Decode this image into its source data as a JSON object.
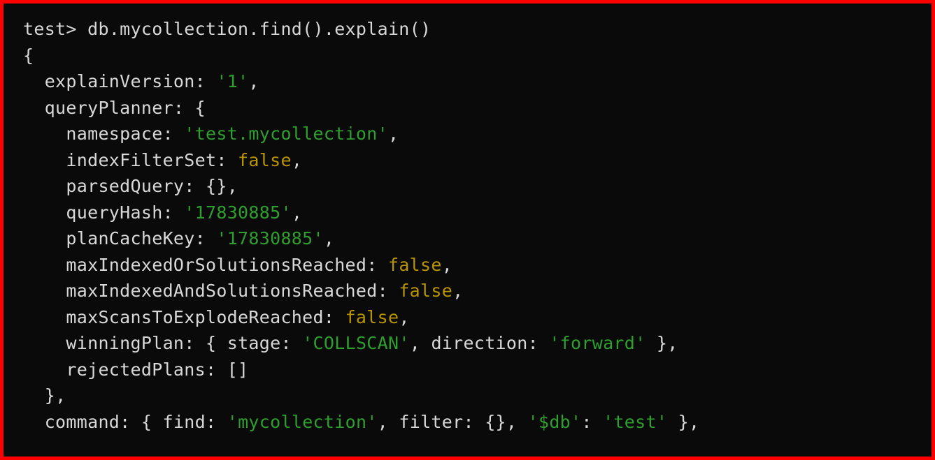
{
  "prompt_db": "test",
  "prompt_sep": ">",
  "command_line": "db.mycollection.find().explain()",
  "kv": {
    "explainVersion": "explainVersion",
    "queryPlanner": "queryPlanner",
    "namespace": "namespace",
    "indexFilterSet": "indexFilterSet",
    "parsedQuery": "parsedQuery",
    "queryHash": "queryHash",
    "planCacheKey": "planCacheKey",
    "maxIndexedOrSolutionsReached": "maxIndexedOrSolutionsReached",
    "maxIndexedAndSolutionsReached": "maxIndexedAndSolutionsReached",
    "maxScansToExplodeReached": "maxScansToExplodeReached",
    "winningPlan": "winningPlan",
    "stage": "stage",
    "direction": "direction",
    "rejectedPlans": "rejectedPlans",
    "command": "command",
    "find": "find",
    "filter": "filter",
    "db": "'$db'"
  },
  "val": {
    "explainVersion": "'1'",
    "namespace": "'test.mycollection'",
    "indexFilterSet": "false",
    "queryHash": "'17830885'",
    "planCacheKey": "'17830885'",
    "maxIndexedOrSolutionsReached": "false",
    "maxIndexedAndSolutionsReached": "false",
    "maxScansToExplodeReached": "false",
    "stage": "'COLLSCAN'",
    "direction": "'forward'",
    "find": "'mycollection'",
    "dbval": "'test'"
  },
  "punct": {
    "obrace": "{",
    "cbrace": "}",
    "colon": ":",
    "comma": ",",
    "sp": " ",
    "obracket": "[",
    "cbracket": "]",
    "emptyobj": "{}",
    "emptyarr": "[]"
  }
}
